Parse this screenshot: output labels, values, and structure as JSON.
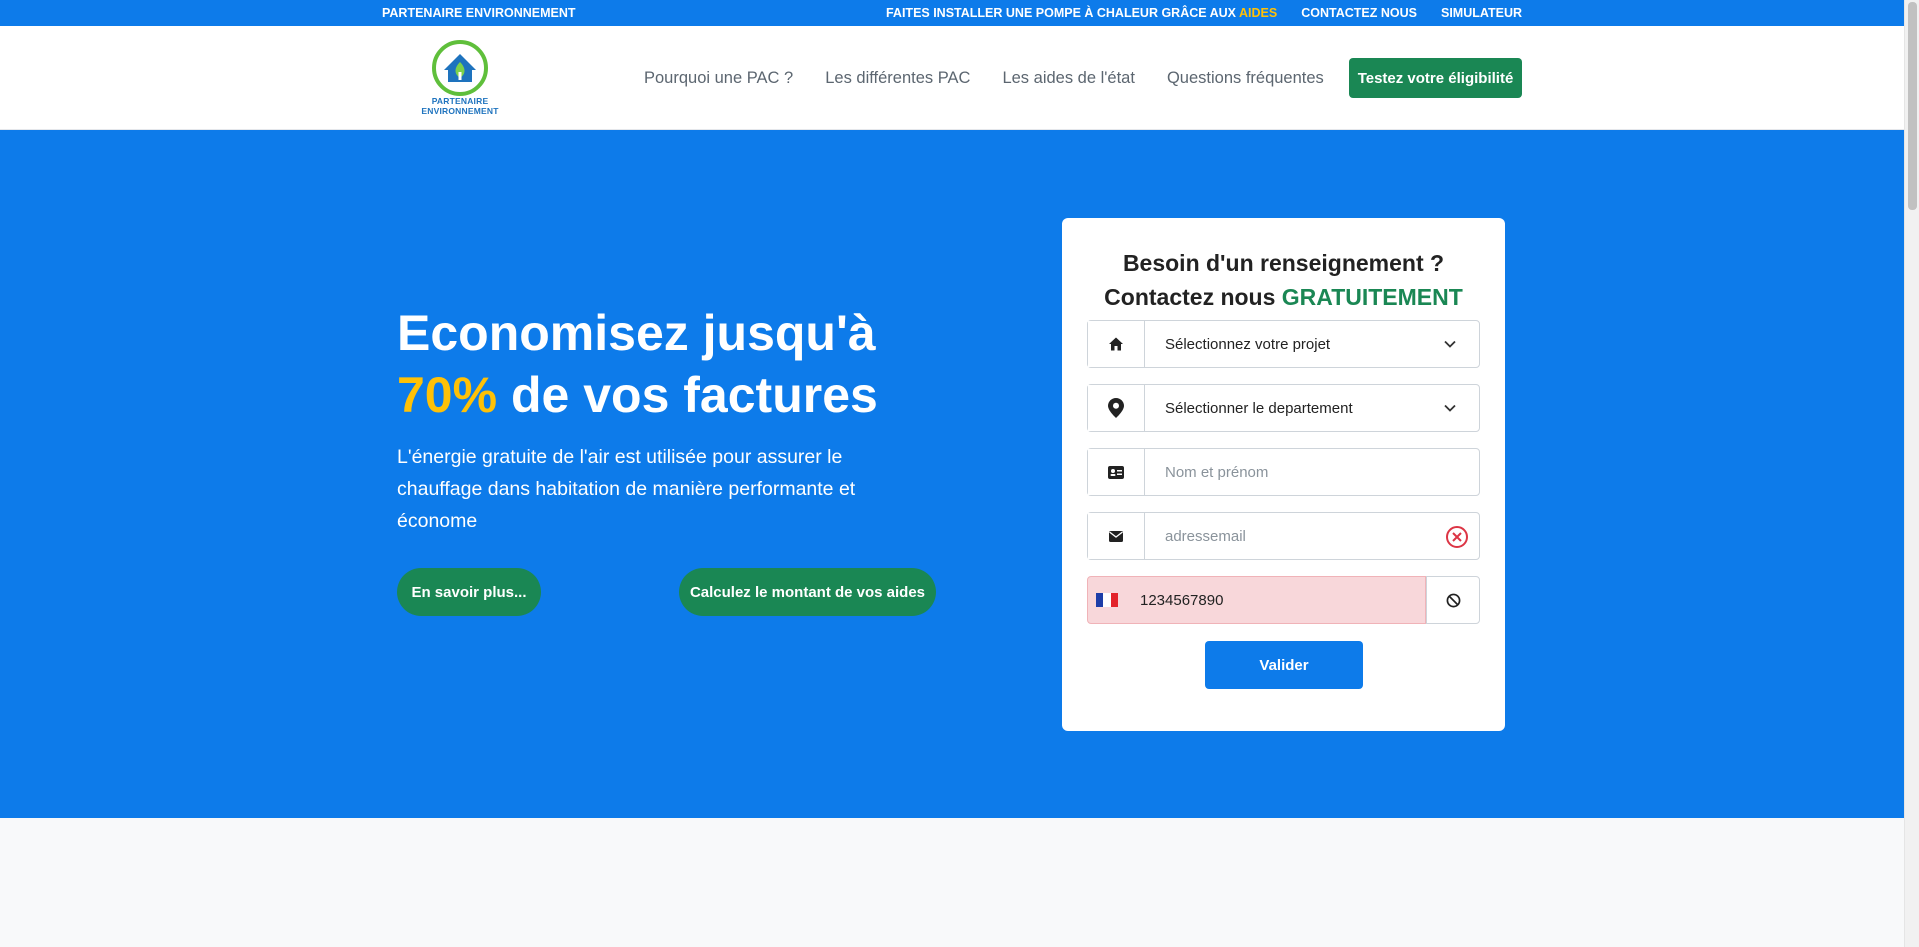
{
  "topbar": {
    "brand": "PARTENAIRE ENVIRONNEMENT",
    "promo_prefix": "FAITES INSTALLER UNE POMPE À CHALEUR GRÂCE AUX",
    "promo_highlight": "AIDES",
    "contact": "CONTACTEZ NOUS",
    "simulator": "SIMULATEUR",
    "background": "#0d7bea",
    "highlight_color": "#ffc107"
  },
  "header": {
    "logo_text": "PARTENAIRE ENVIRONNEMENT",
    "nav": [
      "Pourquoi une PAC ?",
      "Les différentes PAC",
      "Les aides de l'état",
      "Questions fréquentes"
    ],
    "cta": "Testez votre éligibilité",
    "cta_color": "#1a8754"
  },
  "hero": {
    "title_line1": "Economisez jusqu'à",
    "title_percent": "70%",
    "title_rest": "de vos factures",
    "lead": "L'énergie gratuite de l'air est utilisée pour assurer le chauffage dans habitation de manière performante et économe",
    "btn_more": "En savoir plus...",
    "btn_calc": "Calculez le montant de vos aides",
    "background": "#0d7bea"
  },
  "form": {
    "title_line1": "Besoin d'un renseignement ?",
    "title_line2_prefix": "Contactez nous",
    "title_line2_highlight": "GRATUITEMENT",
    "project_select": "Sélectionnez votre projet",
    "department_select": "Sélectionner le departement",
    "name_placeholder": "Nom et prénom",
    "email_placeholder": "adressemail",
    "phone_value": "1234567890",
    "submit": "Valider",
    "icons": [
      "home-icon",
      "map-pin-icon",
      "id-card-icon",
      "envelope-icon",
      "error-x-icon",
      "ban-icon",
      "france-flag-icon"
    ]
  }
}
